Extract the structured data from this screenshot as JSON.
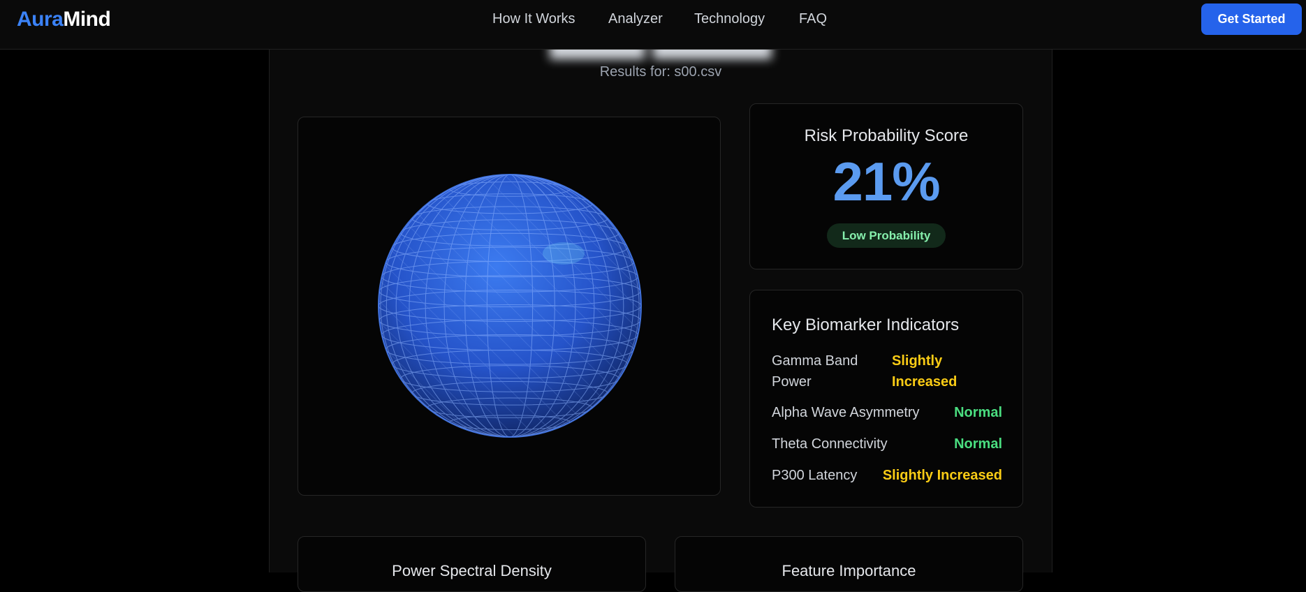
{
  "navbar": {
    "logo_part1": "Aura",
    "logo_part2": "Mind",
    "links": [
      "How It Works",
      "Analyzer",
      "Technology",
      "FAQ"
    ],
    "cta_label": "Get Started"
  },
  "results": {
    "subtitle": "Results for: s00.csv"
  },
  "risk": {
    "title": "Risk Probability Score",
    "value": "21%",
    "badge": "Low Probability"
  },
  "biomarkers": {
    "title": "Key Biomarker Indicators",
    "items": [
      {
        "name": "Gamma Band Power",
        "status": "Slightly Increased"
      },
      {
        "name": "Alpha Wave Asymmetry",
        "status": "Normal"
      },
      {
        "name": "Theta Connectivity",
        "status": "Normal"
      },
      {
        "name": "P300 Latency",
        "status": "Slightly Increased"
      }
    ]
  },
  "charts": {
    "psd_title": "Power Spectral Density",
    "feature_title": "Feature Importance"
  },
  "colors": {
    "accent": "#2563eb",
    "risk_value": "#5b9bf0",
    "normal": "#4ade80",
    "warning": "#facc15",
    "sphere": "#2f63d8"
  },
  "icons": {
    "visualization": "eeg-sphere-visualization"
  }
}
